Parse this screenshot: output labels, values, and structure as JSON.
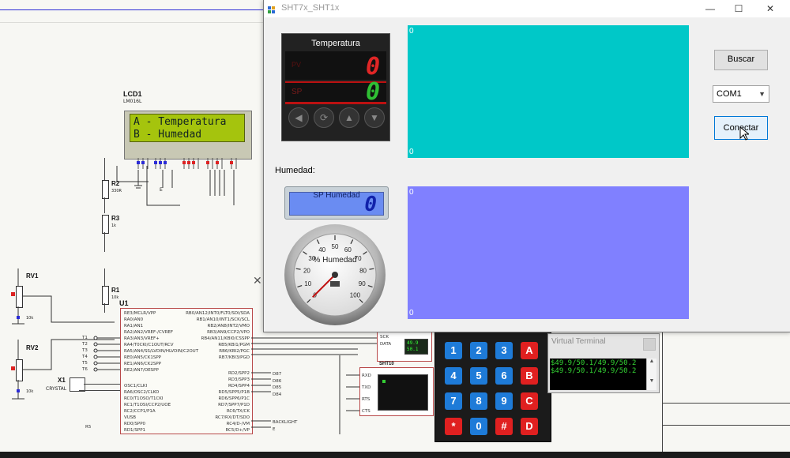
{
  "window": {
    "title": "SHT7x_SHT1x",
    "minimize": "—",
    "maximize": "☐",
    "close": "✕"
  },
  "temperature_controller": {
    "title": "Temperatura",
    "pv_value": "0",
    "sp_label": "SP",
    "sp_value": "0",
    "pv_mark": "PV",
    "buttons": [
      "◀",
      "⟳",
      "▲",
      "▼"
    ]
  },
  "temp_chart": {
    "bg": "#00c8c8",
    "y_top": "0",
    "y_bottom": "0"
  },
  "humidity": {
    "label": "Humedad:",
    "sp_label": "SP Humedad",
    "sp_value": "0",
    "gauge_label": "% Humedad",
    "gauge_ticks": [
      "0",
      "10",
      "20",
      "30",
      "40",
      "50",
      "60",
      "70",
      "80",
      "90",
      "100"
    ],
    "gauge_value": 0
  },
  "hum_chart": {
    "bg": "#8080ff",
    "y_top": "0",
    "y_bottom": "0"
  },
  "controls": {
    "buscar": "Buscar",
    "port": "COM1",
    "conectar": "Conectar"
  },
  "lcd": {
    "ref": "LCD1",
    "model": "LM016L",
    "line1": "A - Temperatura",
    "line2": "B - Humedad"
  },
  "schematic": {
    "u1": "U1",
    "r1": "R1",
    "r1_val": "10k",
    "r2": "R2",
    "r2_val": "330R",
    "r3": "R3",
    "r3_val": "1k",
    "rv1": "RV1",
    "rv1_val": "10k",
    "rv2": "RV2",
    "rv2_val": "10k",
    "x1": "X1",
    "x1_val": "CRYSTAL",
    "sht": "SHT10",
    "sht_pins": [
      "SCK",
      "DATA"
    ],
    "sht_readout": [
      "49.9",
      "50.1"
    ],
    "rx_pins": [
      "RXD",
      "TXD",
      "RTS",
      "CTS"
    ],
    "pic_left_pins": [
      "RE3/MCLR/VPP",
      "RA0/AN0",
      "RA1/AN1",
      "RA2/AN2/VREF-/CVREF",
      "RA3/AN3/VREF+",
      "RA4/T0CKI/C1OUT/RCV",
      "RA5/AN4/SS/LVDIN/HLVDIN/C2OUT",
      "RE0/AN5/CK1SPP",
      "RE1/AN6/CK2SPP",
      "RE2/AN7/OESPP"
    ],
    "pic_left_pins2": [
      "OSC1/CLKI",
      "RA6/OSC2/CLKO",
      "RC0/T1OSO/T1CKI",
      "RC1/T1OSI/CCP2/UOE",
      "RC2/CCP1/P1A",
      "VUSB",
      "RD0/SPP0",
      "RD1/SPP1"
    ],
    "pic_right_pins": [
      "RB0/AN12/INT0/FLT0/SDI/SDA",
      "RB1/AN10/INT1/SCK/SCL",
      "RB2/AN8/INT2/VMO",
      "RB3/AN9/CCP2/VPO",
      "RB4/AN11/KBI0/CSSPP",
      "RB5/KBI1/PGM",
      "RB6/KBI2/PGC",
      "RB7/KBI3/PGD"
    ],
    "pic_right_pins2": [
      "RD2/SPP2",
      "RD3/SPP3",
      "RD4/SPP4",
      "RD5/SPP5/P1B",
      "RD6/SPP6/P1C",
      "RD7/SPP7/P1D",
      "RC6/TX/CK",
      "RC7/RX/DT/SDO",
      "RC4/D-/VM",
      "RC5/D+/VP"
    ],
    "right_nets": [
      "D87",
      "D86",
      "D85",
      "D84",
      "BACKLIGHT",
      "E"
    ],
    "t_labels": [
      "T1",
      "T2",
      "T3",
      "T4",
      "T5",
      "T6"
    ],
    "r_labels": [
      "R5"
    ]
  },
  "keypad": {
    "keys": [
      "1",
      "2",
      "3",
      "A",
      "4",
      "5",
      "6",
      "B",
      "7",
      "8",
      "9",
      "C",
      "*",
      "0",
      "#",
      "D"
    ]
  },
  "terminal": {
    "title": "Virtual Terminal",
    "lines": [
      "$49.9/50.1/49.9/50.2",
      "$49.9/50.1/49.9/50.2"
    ]
  },
  "colors": {
    "temp_chart": "#00c8c8",
    "hum_chart": "#8080ff",
    "lcd_green": "#a5c40d",
    "wire": "#2b2bd6",
    "key_blue": "#1e7bd8",
    "key_red": "#e02020"
  }
}
